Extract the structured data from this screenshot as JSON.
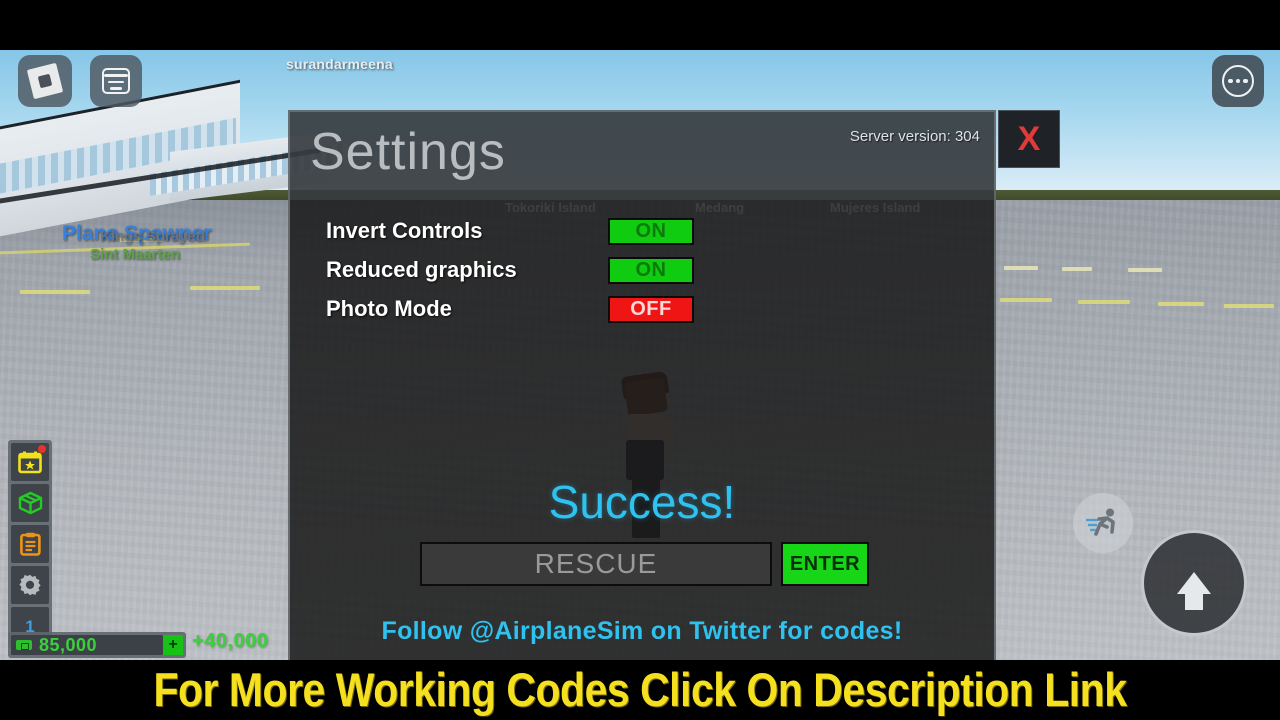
{
  "caption": {
    "text": "For More Working Codes Click On Description Link",
    "color": "#f5e020"
  },
  "roblox_chrome": {
    "username": "surandarmeena",
    "logo_button": "Roblox menu",
    "chat_button": "Chat",
    "more_button": "More options"
  },
  "world_labels": {
    "plane_spawner": "Plane Spawner",
    "kings_sprayed": "Kings Sprayed",
    "sint_maarten": "Sint Maarten",
    "bleed_left": "Tokoriki Island",
    "bleed_mid": "Medang",
    "bleed_right": "Mujeres Island"
  },
  "sidebar": {
    "items": [
      {
        "name": "daily-rewards",
        "icon": "calendar-star-icon",
        "badge": true
      },
      {
        "name": "crates",
        "icon": "package-icon",
        "badge": false
      },
      {
        "name": "quests",
        "icon": "clipboard-icon",
        "badge": false
      },
      {
        "name": "settings",
        "icon": "gear-icon",
        "badge": false
      },
      {
        "name": "level",
        "icon": "level-indicator",
        "level": "1",
        "badge": false
      }
    ]
  },
  "hud": {
    "money": "85,000",
    "money_gain": "+40,000",
    "add_money_label": "+",
    "sprint_icon": "running-man-icon",
    "jump_icon": "up-arrow-icon"
  },
  "settings_panel": {
    "title": "Settings",
    "server_version": "Server version: 304",
    "close_label": "X",
    "rows": [
      {
        "label": "Invert Controls",
        "value": "ON",
        "state": "on"
      },
      {
        "label": "Reduced graphics",
        "value": "ON",
        "state": "on"
      },
      {
        "label": "Photo Mode",
        "value": "OFF",
        "state": "off"
      }
    ],
    "success_message": "Success!",
    "code_placeholder": "RESCUE",
    "enter_label": "ENTER",
    "twitter_line": "Follow  @AirplaneSim  on Twitter for codes!",
    "colors": {
      "on_bg": "#10cc10",
      "off_bg": "#ef1515",
      "accent_cyan": "#2ec2f0",
      "enter_green": "#17d617",
      "close_red": "#e03a3a"
    }
  }
}
